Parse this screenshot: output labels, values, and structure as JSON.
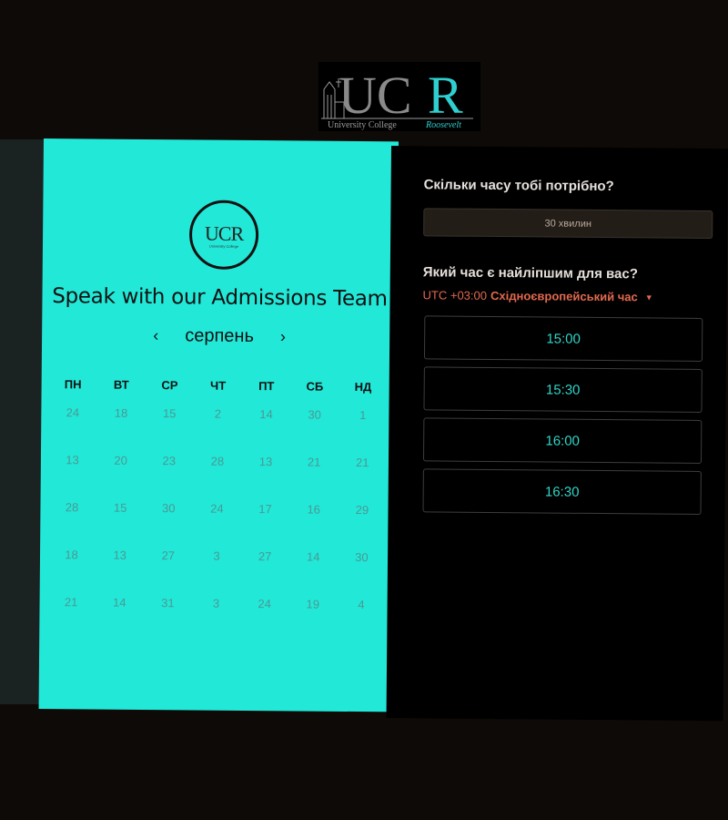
{
  "logo": {
    "initials": "UCR",
    "subtitle_left": "University College",
    "subtitle_right": "Roosevelt"
  },
  "booking": {
    "title": "Speak with our Admissions Team",
    "calendar": {
      "month": "серпень",
      "prev_icon": "chevron-left-icon",
      "next_icon": "chevron-right-icon",
      "weekdays": [
        "ПН",
        "ВТ",
        "СР",
        "ЧТ",
        "ПТ",
        "СБ",
        "НД"
      ],
      "rows": [
        [
          "24",
          "18",
          "15",
          "2",
          "14",
          "30",
          "1"
        ],
        [
          "13",
          "20",
          "23",
          "28",
          "13",
          "21",
          "21"
        ],
        [
          "28",
          "15",
          "30",
          "24",
          "17",
          "16",
          "29"
        ],
        [
          "18",
          "13",
          "27",
          "3",
          "27",
          "14",
          "30"
        ],
        [
          "21",
          "14",
          "31",
          "3",
          "24",
          "19",
          "4"
        ]
      ]
    }
  },
  "scheduler": {
    "duration_question": "Скільки часу тобі потрібно?",
    "duration_value": "30 хвилин",
    "time_question": "Який час є найліпшим для вас?",
    "timezone_offset": "UTC +03:00",
    "timezone_name": "Східноєвропейський час",
    "slots": [
      "15:00",
      "15:30",
      "16:00",
      "16:30"
    ]
  },
  "colors": {
    "accent_teal": "#22e8d8",
    "slot_text": "#2fd6c8",
    "timezone_text": "#e2694f",
    "background": "#0e0a07"
  }
}
